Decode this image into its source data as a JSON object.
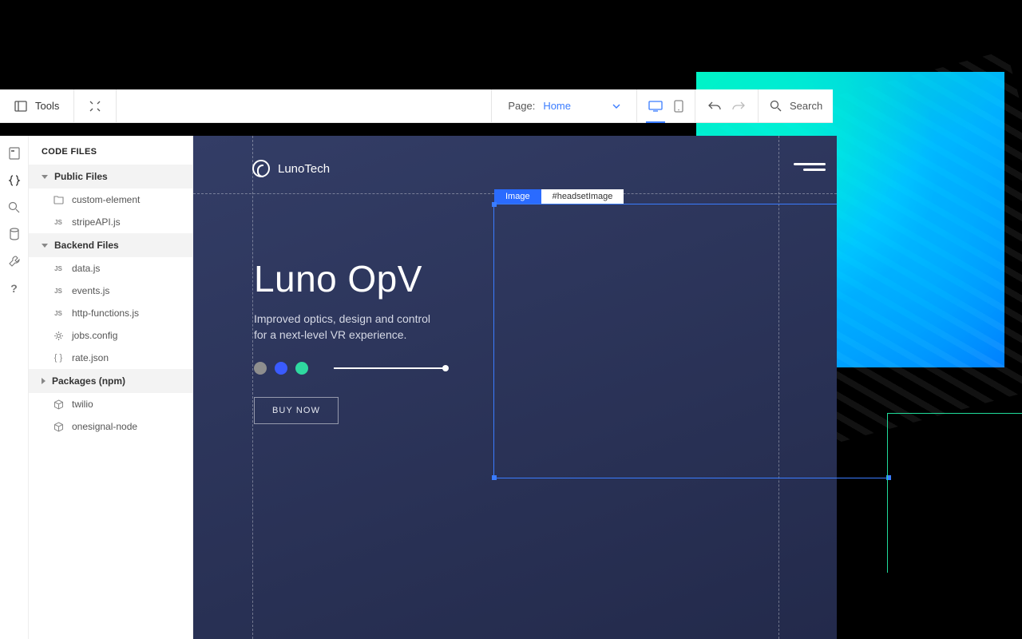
{
  "toolbar": {
    "tools_label": "Tools",
    "page_label": "Page:",
    "page_value": "Home",
    "search_placeholder": "Search"
  },
  "panel": {
    "title": "CODE FILES",
    "groups": [
      {
        "label": "Public Files",
        "expanded": true,
        "items": [
          {
            "icon": "folder",
            "name": "custom-element"
          },
          {
            "icon": "js",
            "name": "stripeAPI.js"
          }
        ]
      },
      {
        "label": "Backend Files",
        "expanded": true,
        "items": [
          {
            "icon": "js",
            "name": "data.js"
          },
          {
            "icon": "js",
            "name": "events.js"
          },
          {
            "icon": "js",
            "name": "http-functions.js"
          },
          {
            "icon": "gear",
            "name": "jobs.config"
          },
          {
            "icon": "braces",
            "name": "rate.json"
          }
        ]
      },
      {
        "label": "Packages (npm)",
        "expanded": false,
        "items": [
          {
            "icon": "pkg",
            "name": "twilio"
          },
          {
            "icon": "pkg",
            "name": "onesignal-node"
          }
        ]
      }
    ]
  },
  "canvas": {
    "brand": "LunoTech",
    "hero_title": "Luno OpV",
    "hero_sub": "Improved optics, design and control for a next-level VR experience.",
    "buy_label": "BUY NOW",
    "swatches": [
      "#8e8e8e",
      "#3a5bff",
      "#2fd9a0"
    ],
    "selection": {
      "type_label": "Image",
      "id_label": "#headsetImage"
    }
  }
}
